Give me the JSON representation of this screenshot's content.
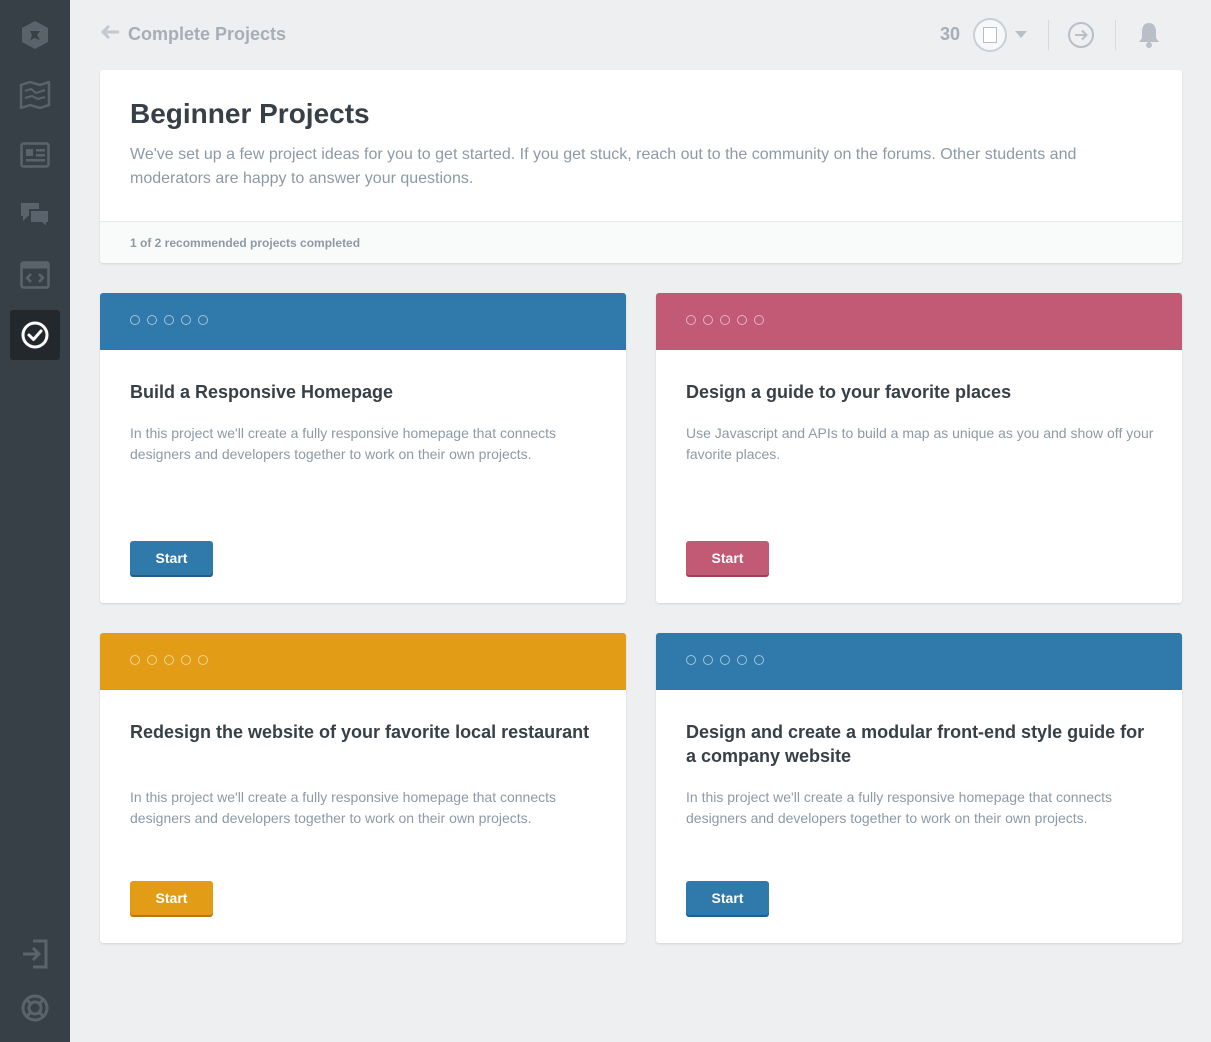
{
  "colors": {
    "blue": "#3079ab",
    "pink": "#c25975",
    "orange": "#e39c15",
    "sidebar": "#384047"
  },
  "sidebar": {
    "items": [
      {
        "icon": "treehouse-logo-icon"
      },
      {
        "icon": "map-icon"
      },
      {
        "icon": "library-icon"
      },
      {
        "icon": "forum-icon"
      },
      {
        "icon": "code-icon"
      },
      {
        "icon": "projects-check-icon",
        "active": true
      },
      {
        "icon": "sign-out-icon"
      },
      {
        "icon": "support-icon"
      }
    ]
  },
  "header": {
    "back_label": "Complete Projects",
    "points": "30"
  },
  "intro": {
    "title": "Beginner Projects",
    "description": "We've set up a few project ideas for you to get started. If you get stuck, reach out to the community on the forums. Other students and moderators are happy to answer your questions.",
    "progress": "1 of 2 recommended projects completed"
  },
  "projects": [
    {
      "title": "Build a Responsive Homepage",
      "description": "In this project we'll create a fully responsive homepage that connects designers and developers together to work on their own projects.",
      "button": "Start",
      "color": "#3079ab"
    },
    {
      "title": "Design a guide to your favorite places",
      "description": "Use Javascript and APIs to build a map as unique as you and show off your favorite places.",
      "button": "Start",
      "color": "#c25975"
    },
    {
      "title": "Redesign the website of your favorite local restaurant",
      "description": "In this project we'll create a fully responsive homepage that connects designers and developers together to work on their own projects.",
      "button": "Start",
      "color": "#e39c15"
    },
    {
      "title": "Design and create a modular front-end style guide for a company website",
      "description": "In this project we'll create a fully responsive homepage that connects designers and developers together to work on their own projects.",
      "button": "Start",
      "color": "#3079ab"
    }
  ]
}
